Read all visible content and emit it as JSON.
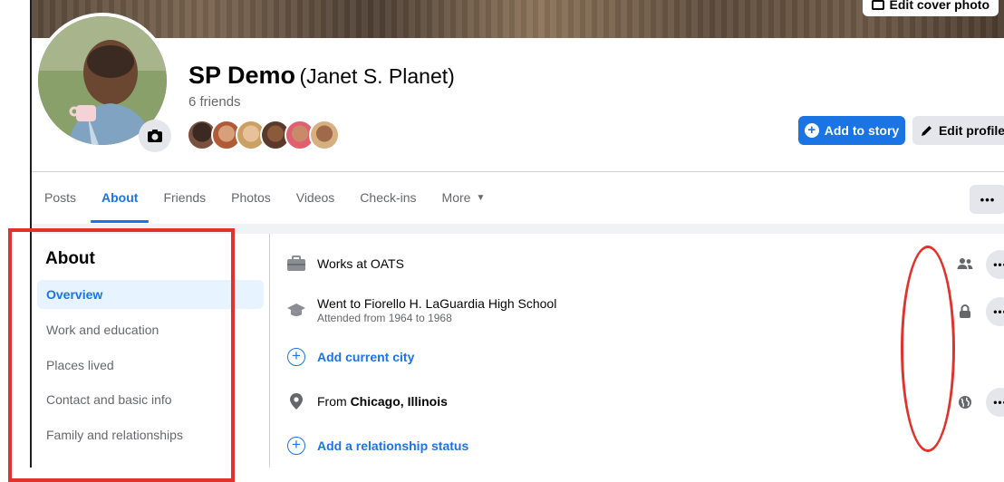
{
  "cover": {
    "edit_cover_label": "Edit cover photo"
  },
  "profile": {
    "name": "SP Demo",
    "alt_name": "(Janet S. Planet)",
    "friends_count": "6 friends"
  },
  "actions": {
    "add_to_story": "Add to story",
    "edit_profile": "Edit profile",
    "more_dots": "•••"
  },
  "tabs": [
    {
      "label": "Posts"
    },
    {
      "label": "About"
    },
    {
      "label": "Friends"
    },
    {
      "label": "Photos"
    },
    {
      "label": "Videos"
    },
    {
      "label": "Check-ins"
    },
    {
      "label": "More"
    }
  ],
  "about_nav": {
    "title": "About",
    "items": [
      {
        "label": "Overview"
      },
      {
        "label": "Work and education"
      },
      {
        "label": "Places lived"
      },
      {
        "label": "Contact and basic info"
      },
      {
        "label": "Family and relationships"
      }
    ]
  },
  "overview": {
    "work": "Works at OATS",
    "education": "Went to Fiorello H. LaGuardia High School",
    "education_sub": "Attended from 1964 to 1968",
    "add_city": "Add current city",
    "from_prefix": "From ",
    "from_place": "Chicago, Illinois",
    "add_relationship": "Add a relationship status"
  },
  "colors": {
    "accent": "#1b74e4",
    "annotation": "#e0332b",
    "text_secondary": "#65676b"
  },
  "icons": [
    "camera-icon",
    "briefcase-icon",
    "graduation-cap-icon",
    "plus-circle-icon",
    "location-pin-icon",
    "friends-icon",
    "lock-icon",
    "globe-icon",
    "pencil-icon",
    "more-icon"
  ]
}
